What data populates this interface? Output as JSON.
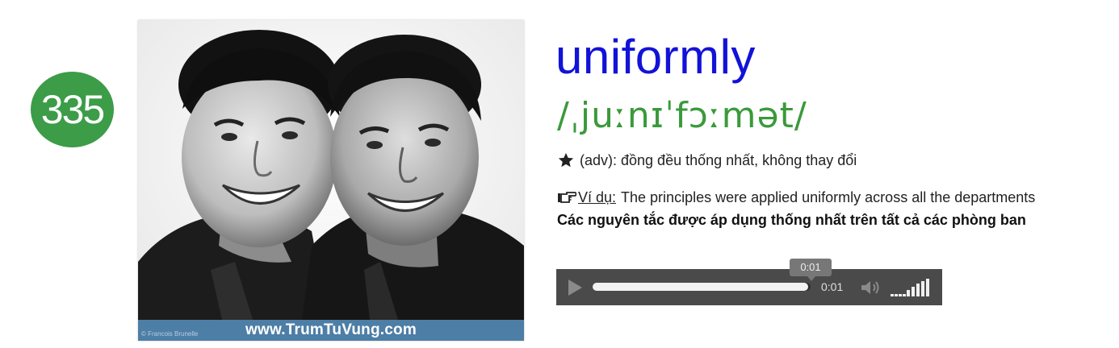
{
  "word": {
    "number": "335",
    "headword": "uniformly",
    "ipa": "/ˌjuːnɪˈfɔːmət/",
    "meaning": "(adv): đồng đều thống nhất, không thay đổi",
    "example_label": "Ví dụ:",
    "example_sentence": "The principles were applied uniformly across all the departments",
    "translation": "Các nguyên tắc được áp dụng thống nhất trên tất cả các phòng ban"
  },
  "image": {
    "watermark": "www.TrumTuVung.com",
    "credit": "© Francois Brunelle"
  },
  "player": {
    "tooltip_time": "0:01",
    "current_time": "0:01",
    "progress": 0.99,
    "volume_level": 1.0
  },
  "colors": {
    "number_badge": "#3c9c48",
    "headword": "#1212d8",
    "ipa": "#3a9a3a",
    "player_bg": "#4a4a4a"
  },
  "icons": {
    "meaning": "star-icon",
    "example": "pointing-hand-icon",
    "play": "play-icon",
    "mute": "speaker-icon",
    "volume": "volume-bars-icon"
  }
}
